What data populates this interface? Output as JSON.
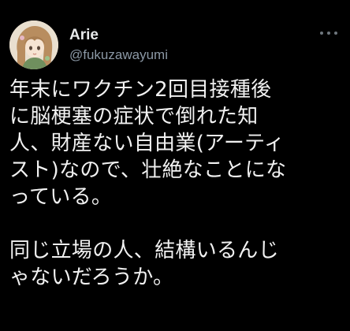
{
  "tweet": {
    "author": {
      "display_name": "Arie",
      "handle": "@fukuzawayumi",
      "avatar_icon": "avatar-illustration-icon"
    },
    "more_icon": "more-options-icon",
    "body": {
      "paragraph_1": [
        "年末にワクチン2回目接種後",
        "に脳梗塞の症状で倒れた知",
        "人、財産ない自由業(アーティ",
        "スト)なので、壮絶なことにな",
        "っている。"
      ],
      "paragraph_2": [
        "同じ立場の人、結構いるんじ",
        "ゃないだろうか。"
      ]
    },
    "colors": {
      "background": "#000000",
      "name": "#e7e9ea",
      "handle": "#8b98a5",
      "text": "#f1f1f1"
    }
  }
}
